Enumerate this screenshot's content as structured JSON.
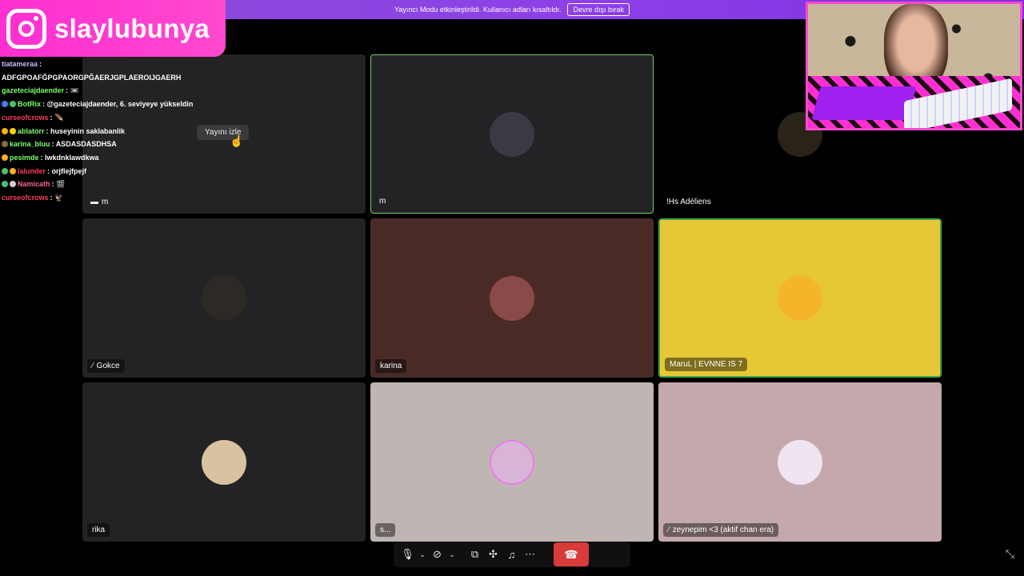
{
  "banner": {
    "text": "Yayıncı Modu etkinleştirildi. Kullanıcı adları kısaltıldı.",
    "button": "Devre dışı bırak"
  },
  "overlay": {
    "instagram_handle": "slaylubunya"
  },
  "chat": [
    {
      "user": "tiatameraa",
      "color": "#c9b8ff",
      "message": "",
      "badges": []
    },
    {
      "user": "",
      "color": "#ffffff",
      "message": "ADFGPOAFĞPGPAORGPĞAERJGPLAEROIJGAERH",
      "badges": []
    },
    {
      "user": "gazeteciajdaender",
      "color": "#7cff6b",
      "message": "📼",
      "badges": []
    },
    {
      "user": "BotRix",
      "color": "#7cff6b",
      "message": "@gazeteciajdaender, 6. seviyeye yükseldin",
      "badges": [
        "#3f7bff",
        "#47c26b"
      ]
    },
    {
      "user": "curseofcrows",
      "color": "#ff3b5c",
      "message": "🪶",
      "badges": []
    },
    {
      "user": "ablatorr",
      "color": "#7cff6b",
      "message": "huseyinin saklabanlik",
      "badges": [
        "#ffb21a",
        "#ffd000"
      ]
    },
    {
      "user": "karina_bluu",
      "color": "#7cff6b",
      "message": "ASDASDASDHSA",
      "badges": [
        "#8a6a3a"
      ]
    },
    {
      "user": "pesimde",
      "color": "#7cff6b",
      "message": "lwkdnklawdkwa",
      "badges": [
        "#ffb21a"
      ]
    },
    {
      "user": "lalunder",
      "color": "#ff3b5c",
      "message": "orjflejfpejf",
      "badges": [
        "#47c26b",
        "#ffb21a"
      ]
    },
    {
      "user": "Namicath",
      "color": "#ff5fa0",
      "message": "🎬",
      "badges": [
        "#47c26b",
        "#cfcfcf"
      ]
    },
    {
      "user": "curseofcrows",
      "color": "#ff3b5c",
      "message": "🦅",
      "badges": []
    }
  ],
  "tooltip": "Yayını izle",
  "tiles": [
    {
      "name": "m",
      "bg": "#232325",
      "avatar_color": "",
      "state": "stream"
    },
    {
      "name": "m",
      "bg": "#232325",
      "avatar_color": "#3a3a44",
      "state": "active"
    },
    {
      "name": "!Hs Adéliens",
      "bg": "#000000",
      "avatar_color": "#2a2418",
      "state": "plain"
    },
    {
      "name": "Gokce",
      "bg": "#232325",
      "avatar_color": "#2d2a26",
      "state": "muted"
    },
    {
      "name": "karina",
      "bg": "#4a2a27",
      "avatar_color": "#8a4a4a",
      "state": "normal"
    },
    {
      "name": "MaruL | EVNNE IS 7",
      "bg": "#e6c837",
      "avatar_color": "#f4b52a",
      "state": "speaking"
    },
    {
      "name": "rika",
      "bg": "#232325",
      "avatar_color": "#d9c2a0",
      "state": "normal"
    },
    {
      "name": "s...",
      "bg": "#bfb6b4",
      "avatar_color": "#d8b5d8",
      "state": "normal"
    },
    {
      "name": "zeynepim <3 (aktif chan era)",
      "bg": "#c4a8ac",
      "avatar_color": "#f0e4f0",
      "state": "muted"
    }
  ],
  "controls": [
    "mic-icon",
    "chevron-down-icon",
    "camera-off-icon",
    "chevron-down-icon",
    "screen-share-icon",
    "activities-icon",
    "soundboard-icon",
    "more-icon"
  ],
  "end_call": "phone-hangup-icon"
}
